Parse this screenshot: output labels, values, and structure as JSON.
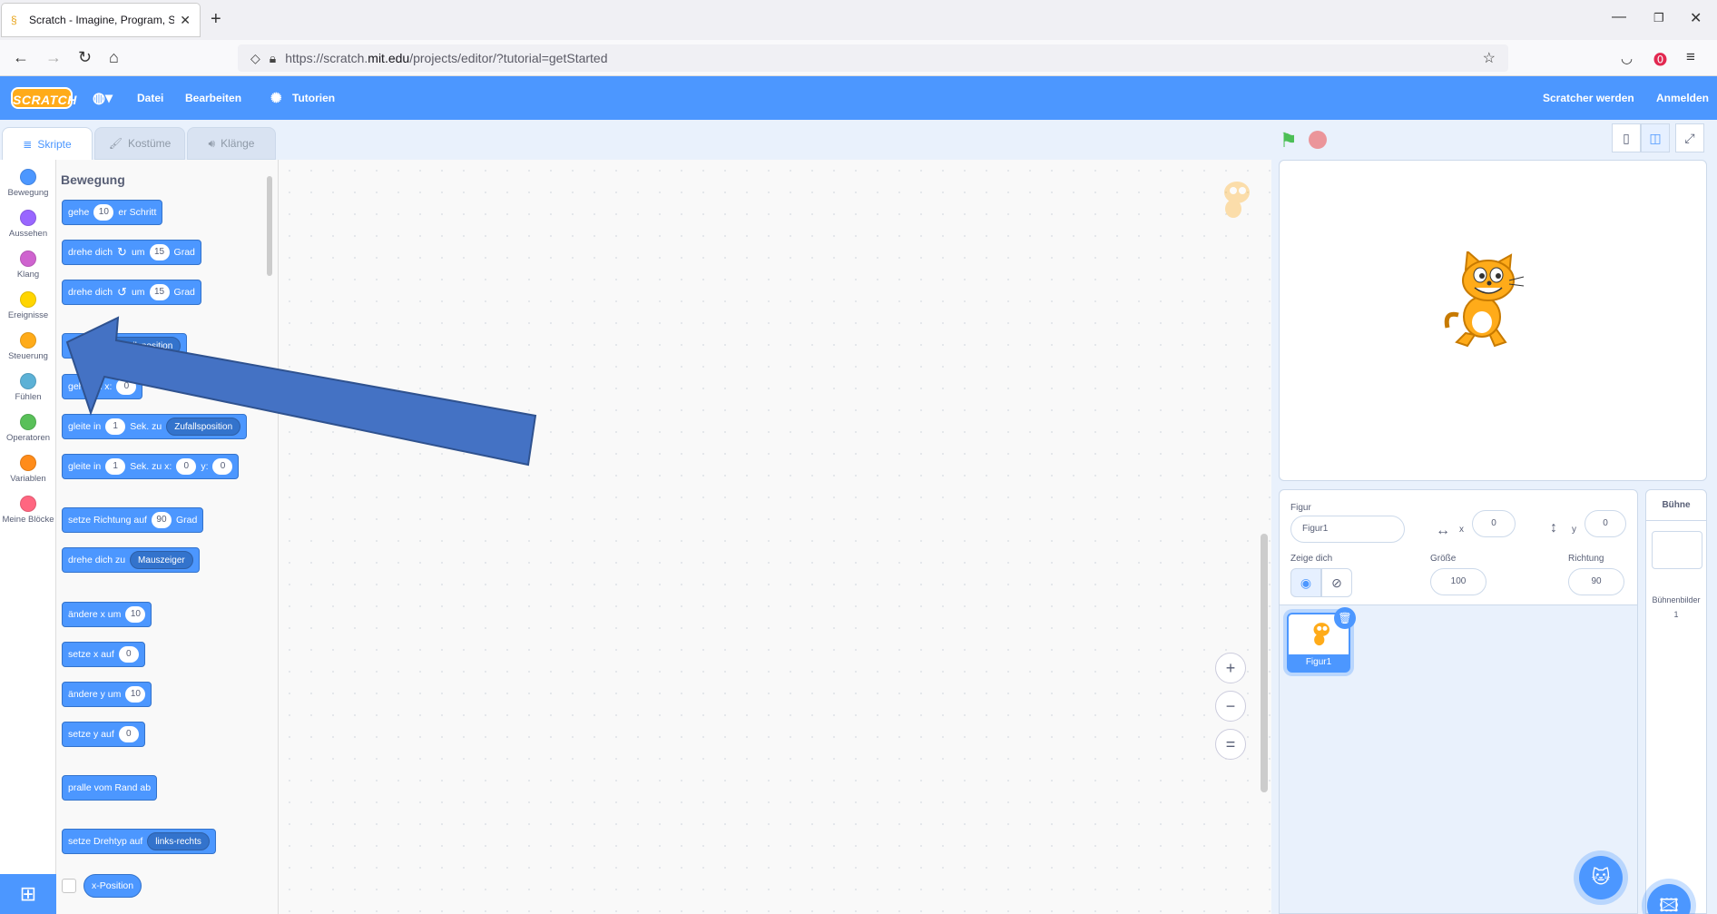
{
  "browser": {
    "tab_title": "Scratch - Imagine, Program, Sh",
    "tab_close": "✕",
    "new_tab": "+",
    "url_prefix": "https://scratch.",
    "url_domain": "mit.edu",
    "url_suffix": "/projects/editor/?tutorial=getStarted"
  },
  "menubar": {
    "logo": "SCRATCH",
    "file": "Datei",
    "edit": "Bearbeiten",
    "tutorials": "Tutorien",
    "join": "Scratcher werden",
    "signin": "Anmelden"
  },
  "tabs": {
    "code": "Skripte",
    "costumes": "Kostüme",
    "sounds": "Klänge"
  },
  "categories": [
    {
      "label": "Bewegung",
      "color": "#4c97ff"
    },
    {
      "label": "Aussehen",
      "color": "#9966ff"
    },
    {
      "label": "Klang",
      "color": "#cf63cf"
    },
    {
      "label": "Ereignisse",
      "color": "#ffd500"
    },
    {
      "label": "Steuerung",
      "color": "#ffab19"
    },
    {
      "label": "Fühlen",
      "color": "#5cb1d6"
    },
    {
      "label": "Operatoren",
      "color": "#59c059"
    },
    {
      "label": "Variablen",
      "color": "#ff8c1a"
    },
    {
      "label": "Meine Blöcke",
      "color": "#ff6680"
    }
  ],
  "palette": {
    "title": "Bewegung",
    "b1": {
      "a": "gehe",
      "v": "10",
      "b": "er Schritt"
    },
    "b2": {
      "a": "drehe dich",
      "b": "um",
      "v": "15",
      "c": "Grad"
    },
    "b3": {
      "a": "drehe dich",
      "b": "um",
      "v": "15",
      "c": "Grad"
    },
    "b4": {
      "a": "gehe zu",
      "dd": "Zufallsposition"
    },
    "b5": {
      "a": "gehe zu x:",
      "v": "0"
    },
    "b6": {
      "a": "gleite in",
      "v": "1",
      "b": "Sek. zu",
      "dd": "Zufallsposition"
    },
    "b7": {
      "a": "gleite in",
      "v": "1",
      "b": "Sek. zu x:",
      "x": "0",
      "c": "y:",
      "y": "0"
    },
    "b8": {
      "a": "setze Richtung auf",
      "v": "90",
      "b": "Grad"
    },
    "b9": {
      "a": "drehe dich zu",
      "dd": "Mauszeiger"
    },
    "b10": {
      "a": "ändere x um",
      "v": "10"
    },
    "b11": {
      "a": "setze x auf",
      "v": "0"
    },
    "b12": {
      "a": "ändere y um",
      "v": "10"
    },
    "b13": {
      "a": "setze y auf",
      "v": "0"
    },
    "b14": {
      "a": "pralle vom Rand ab"
    },
    "b15": {
      "a": "setze Drehtyp auf",
      "dd": "links-rechts"
    },
    "r1": "x-Position"
  },
  "zoom": {
    "in": "+",
    "out": "−",
    "reset": "="
  },
  "sprite_info": {
    "sprite_label": "Figur",
    "sprite_name": "Figur1",
    "x_label": "x",
    "x_value": "0",
    "y_label": "y",
    "y_value": "0",
    "show_label": "Zeige dich",
    "size_label": "Größe",
    "size_value": "100",
    "direction_label": "Richtung",
    "direction_value": "90"
  },
  "sprite_card": {
    "name": "Figur1"
  },
  "stage_panel": {
    "title": "Bühne",
    "backdrops_label": "Bühnenbilder",
    "backdrops_count": "1"
  }
}
